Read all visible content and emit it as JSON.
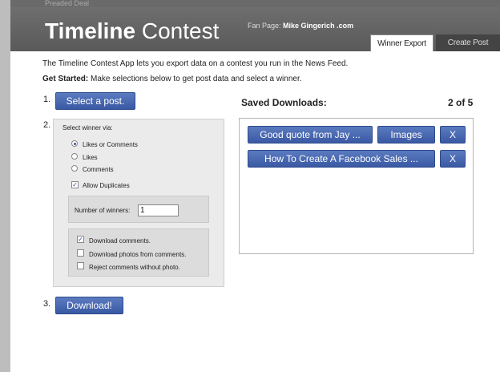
{
  "window": {
    "top_cut_text": "Preaded Deal"
  },
  "header": {
    "logo_bold": "Timeline",
    "logo_light": "Contest",
    "fan_page_label": "Fan Page:",
    "fan_page_name": "Mike Gingerich .com",
    "tabs": [
      {
        "label": "Winner Export",
        "active": true
      },
      {
        "label": "Create Post",
        "active": false
      }
    ]
  },
  "intro": {
    "line1": "The Timeline Contest App lets you export data on a contest you run in the News Feed.",
    "get_started_bold": "Get Started:",
    "get_started_rest": "Make selections below to get post data and select a winner."
  },
  "steps": {
    "step1_num": "1.",
    "select_post_label": "Select a post.",
    "step2_num": "2.",
    "step3_num": "3.",
    "download_label": "Download!"
  },
  "winner_panel": {
    "title": "Select winner via:",
    "radios": [
      {
        "label": "Likes or Comments",
        "selected": true
      },
      {
        "label": "Likes",
        "selected": false
      },
      {
        "label": "Comments",
        "selected": false
      }
    ],
    "allow_duplicates": {
      "label": "Allow Duplicates",
      "checked": true
    },
    "num_winners_label": "Number of winners:",
    "num_winners_value": "1",
    "options": [
      {
        "label": "Download comments.",
        "checked": true
      },
      {
        "label": "Download photos from comments.",
        "checked": false
      },
      {
        "label": "Reject comments without photo.",
        "checked": false
      }
    ]
  },
  "saved_downloads": {
    "title": "Saved Downloads:",
    "count": "2 of 5",
    "items": [
      {
        "name": "Good quote from Jay ...",
        "extra": "Images",
        "delete": "X"
      },
      {
        "name": "How To Create A Facebook Sales ...",
        "extra": null,
        "delete": "X"
      }
    ]
  },
  "colors": {
    "header": "#5f5f5f",
    "button": "#3d5ca6",
    "panel": "#ebebeb"
  }
}
